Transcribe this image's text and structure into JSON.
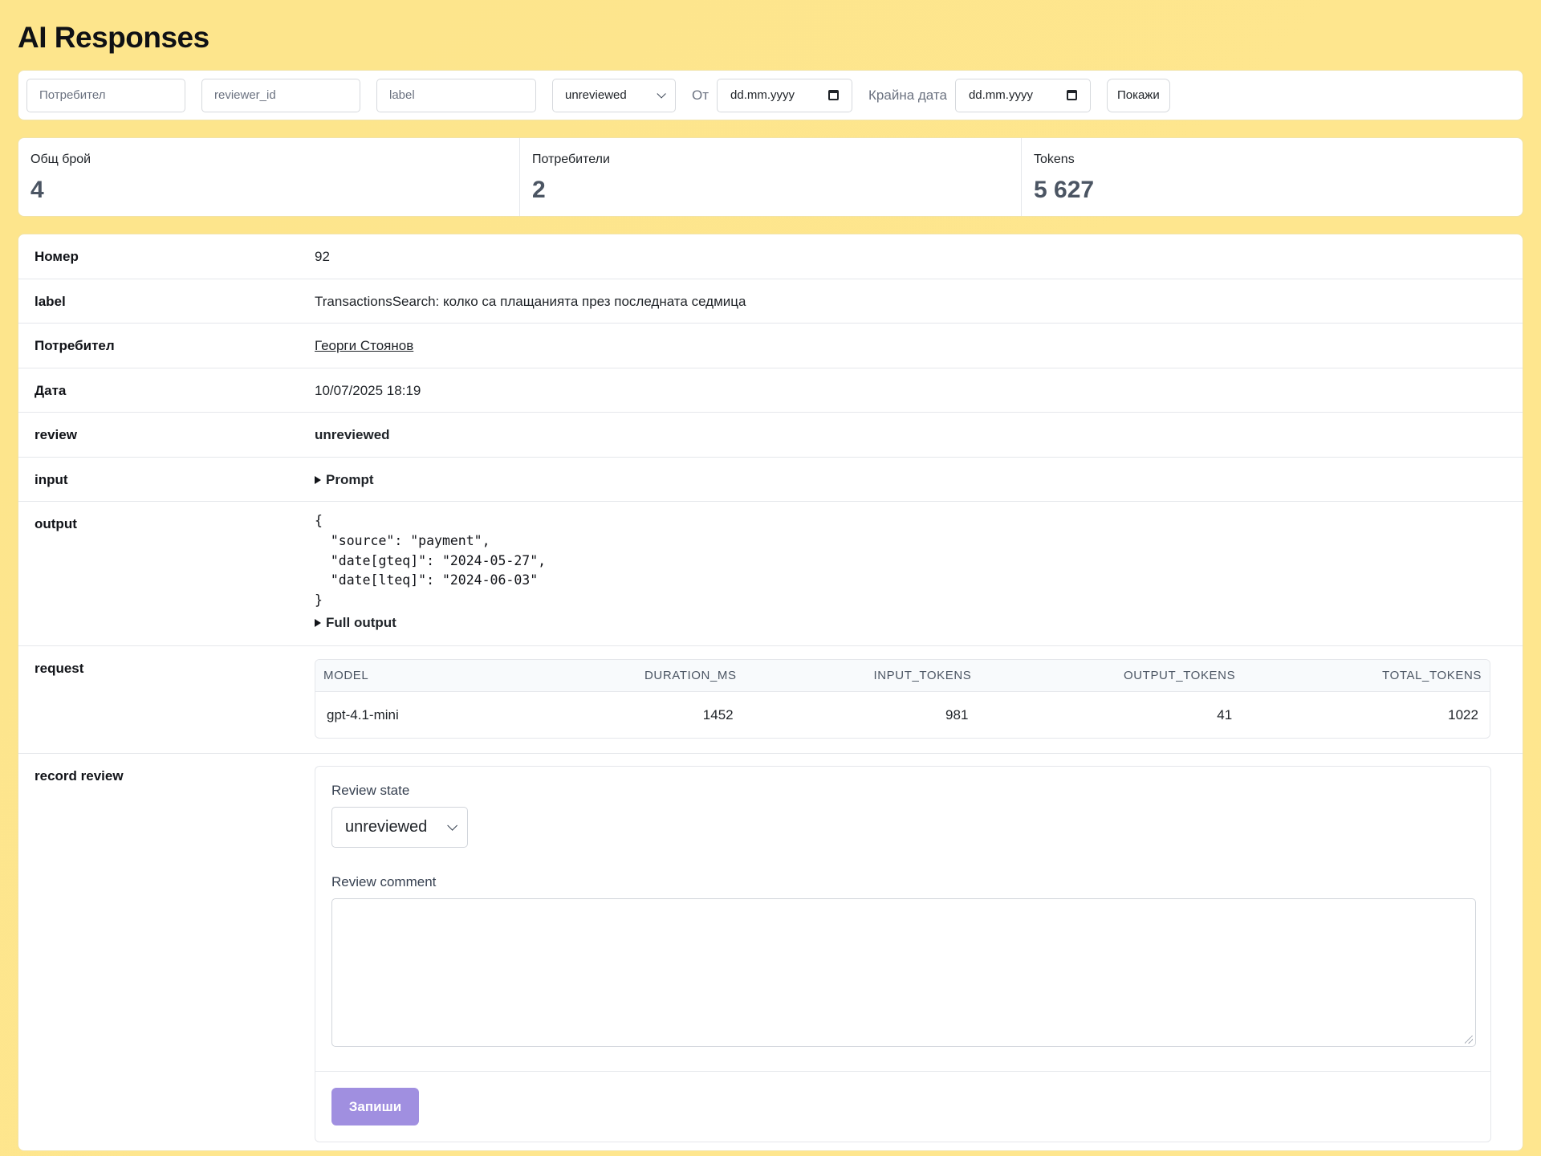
{
  "page": {
    "title": "AI Responses"
  },
  "filters": {
    "user_placeholder": "Потребител",
    "reviewer_placeholder": "reviewer_id",
    "label_placeholder": "label",
    "status_selected": "unreviewed",
    "from_label": "От",
    "from_date": "dd.mm.yyyy",
    "to_label": "Крайна дата",
    "to_date": "dd.mm.yyyy",
    "show_button": "Покажи"
  },
  "stats": [
    {
      "label": "Общ брой",
      "value": "4"
    },
    {
      "label": "Потребители",
      "value": "2"
    },
    {
      "label": "Tokens",
      "value": "5 627"
    }
  ],
  "details": {
    "number_key": "Номер",
    "number_val": "92",
    "label_key": "label",
    "label_val": "TransactionsSearch: колко са плащанията през последната седмица",
    "user_key": "Потребител",
    "user_val": "Георги Стоянов",
    "date_key": "Дата",
    "date_val": "10/07/2025 18:19",
    "review_key": "review",
    "review_val": "unreviewed",
    "input_key": "input",
    "input_summary": "Prompt",
    "output_key": "output",
    "output_json": "{\n  \"source\": \"payment\",\n  \"date[gteq]\": \"2024-05-27\",\n  \"date[lteq]\": \"2024-06-03\"\n}",
    "output_summary": "Full output",
    "request_key": "request",
    "record_review_key": "record review"
  },
  "request_table": {
    "headers": [
      "MODEL",
      "DURATION_MS",
      "INPUT_TOKENS",
      "OUTPUT_TOKENS",
      "TOTAL_TOKENS"
    ],
    "row": [
      "gpt-4.1-mini",
      "1452",
      "981",
      "41",
      "1022"
    ]
  },
  "review_form": {
    "state_label": "Review state",
    "state_selected": "unreviewed",
    "comment_label": "Review comment",
    "comment_value": "",
    "save_button": "Запиши"
  },
  "colors": {
    "background": "#fde68a",
    "save_button": "#a08fe0"
  }
}
